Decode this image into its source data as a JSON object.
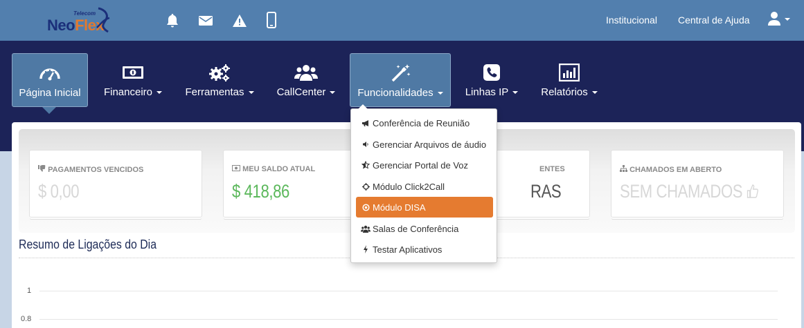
{
  "brand": {
    "name_left": "Neo",
    "name_right": "Flex",
    "tagline": "Telecom"
  },
  "top_links": {
    "institucional": "Institucional",
    "ajuda": "Central de Ajuda"
  },
  "nav": [
    {
      "label": "Página Inicial",
      "icon": "dashboard-icon"
    },
    {
      "label": "Financeiro",
      "icon": "money-icon"
    },
    {
      "label": "Ferramentas",
      "icon": "cogs-icon"
    },
    {
      "label": "CallCenter",
      "icon": "users-icon"
    },
    {
      "label": "Funcionalidades",
      "icon": "magic-wand-icon"
    },
    {
      "label": "Linhas IP",
      "icon": "phone-icon"
    },
    {
      "label": "Relatórios",
      "icon": "bar-chart-icon"
    }
  ],
  "cards": [
    {
      "title": "PAGAMENTOS VENCIDOS",
      "value": "$ 0,00",
      "icon": "thumbs-down-icon"
    },
    {
      "title": "MEU SALDO ATUAL",
      "value": "$ 418,86",
      "icon": "money-icon"
    },
    {
      "title": "ENTES",
      "value": "RAS",
      "icon": ""
    },
    {
      "title": "CHAMADOS EM ABERTO",
      "value": "SEM CHAMADOS",
      "icon": "sitemap-icon"
    }
  ],
  "section": {
    "title": "Resumo de Ligações do Dia"
  },
  "chart_data": {
    "type": "line",
    "title": "Resumo de Ligações do Dia",
    "y_ticks": [
      "1",
      "0.8"
    ],
    "series": []
  },
  "dropdown": {
    "items": [
      {
        "label": "Conferência de Reunião",
        "icon": "bullhorn-icon"
      },
      {
        "label": "Gerenciar Arquivos de áudio",
        "icon": "volume-icon"
      },
      {
        "label": "Gerenciar Portal de Voz",
        "icon": "star-half-icon"
      },
      {
        "label": "Módulo Click2Call",
        "icon": "crosshairs-icon"
      },
      {
        "label": "Módulo DISA",
        "icon": "dot-circle-icon",
        "active": true
      },
      {
        "label": "Salas de Conferência",
        "icon": "users-icon"
      },
      {
        "label": "Testar Aplicativos",
        "icon": "bolt-icon"
      }
    ]
  },
  "colors": {
    "topbar": "#527fae",
    "navbar": "#1c2358",
    "accent": "#e57b30",
    "green": "#5cb85c"
  }
}
